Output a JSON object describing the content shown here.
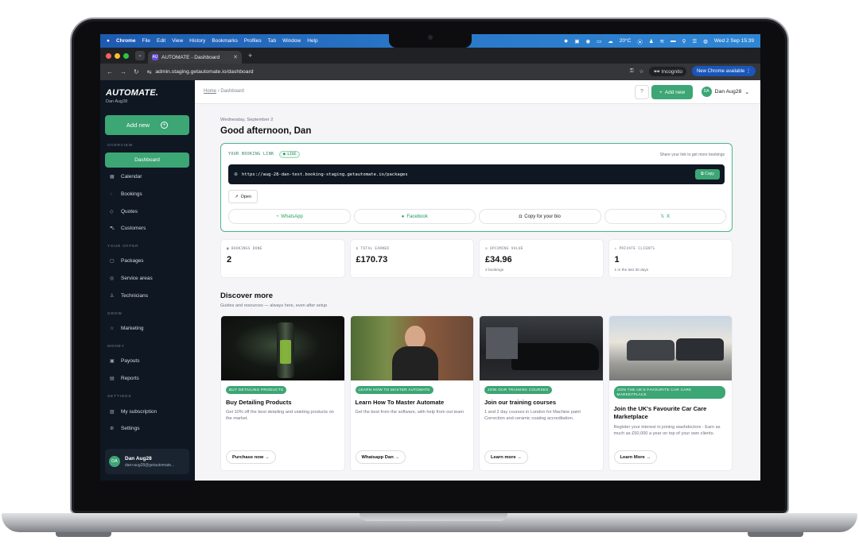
{
  "menubar": {
    "apple": "",
    "items": [
      "Chrome",
      "File",
      "Edit",
      "View",
      "History",
      "Bookmarks",
      "Profiles",
      "Tab",
      "Window",
      "Help"
    ],
    "weather": "20°C",
    "datetime": "Wed 2 Sep  15:39"
  },
  "browser": {
    "tab_title": "AUTOMATE - Dashboard",
    "tab_favicon": "AU",
    "url": "admin.staging.getautomate.io/dashboard",
    "incognito": "Incognito",
    "new_chrome": "New Chrome available"
  },
  "sidebar": {
    "logo": "AUTOMATE.",
    "org": "Dan Aug28",
    "add_new": "Add new",
    "sections": {
      "overview": "OVERVIEW",
      "your_offer": "YOUR OFFER",
      "grow": "GROW",
      "money": "MONEY",
      "settings": "SETTINGS"
    },
    "items": {
      "dashboard": "Dashboard",
      "calendar": "Calendar",
      "bookings": "Bookings",
      "quotes": "Quotes",
      "customers": "Customers",
      "packages": "Packages",
      "service_areas": "Service areas",
      "technicians": "Technicians",
      "marketing": "Marketing",
      "payouts": "Payouts",
      "reports": "Reports",
      "subscription": "My subscription",
      "settings": "Settings"
    },
    "user": {
      "initials": "DA",
      "name": "Dan Aug28",
      "email": "dan+aug28@getautomate..."
    }
  },
  "topbar": {
    "breadcrumb_home": "Home",
    "breadcrumb_sep": "›",
    "breadcrumb_current": "Dashboard",
    "add_new": "Add new",
    "user_initials": "DA",
    "user_name": "Dan Aug28"
  },
  "main": {
    "date": "Wednesday, September 2",
    "greeting": "Good afternoon, Dan"
  },
  "booking_link": {
    "label": "YOUR BOOKING LINK",
    "status": "LIVE",
    "hint": "Share your link to get more bookings",
    "url": "https://aug-28-dan-test.booking-staging.getautomate.io/packages",
    "copy": "Copy",
    "open": "Open",
    "share": {
      "whatsapp": "WhatsApp",
      "facebook": "Facebook",
      "bio": "Copy for your bio",
      "x": "X"
    }
  },
  "stats": [
    {
      "label": "BOOKINGS DONE",
      "value": "2",
      "sub": ""
    },
    {
      "label": "TOTAL EARNED",
      "value": "£170.73",
      "sub": ""
    },
    {
      "label": "UPCOMING VALUE",
      "value": "£34.96",
      "sub": "2 bookings"
    },
    {
      "label": "PRIVATE CLIENTS",
      "value": "1",
      "sub": "1 in the last 30 days"
    }
  ],
  "discover": {
    "title": "Discover more",
    "subtitle": "Guides and resources — always here, even after setup",
    "cards": [
      {
        "tag": "BUY DETAILING PRODUCTS",
        "title": "Buy Detailing Products",
        "desc": "Get 10% off the best detailing and valeting products on the market.",
        "button": "Purchase now →"
      },
      {
        "tag": "LEARN HOW TO MASTER AUTOMATE",
        "title": "Learn How To Master Automate",
        "desc": "Get the best from the software, with help from out team",
        "button": "Whatsapp Dan →"
      },
      {
        "tag": "JOIN OUR TRAINING COURSES",
        "title": "Join our training courses",
        "desc": "1 and 2 day courses in London for Machine paint Correction and ceramic coating accreditation.",
        "button": "Learn more →"
      },
      {
        "tag": "JOIN THE UK'S FAVOURITE CAR CARE MARKETPLACE",
        "title": "Join the UK's Favourite Car Care Marketplace",
        "desc": "Register your interest in joining washdoctors - Earn as much as £50,000 a year on top of your own clients.",
        "button": "Learn More →"
      }
    ]
  },
  "colors": {
    "accent": "#3ca675",
    "sidebar": "#0f1722"
  }
}
